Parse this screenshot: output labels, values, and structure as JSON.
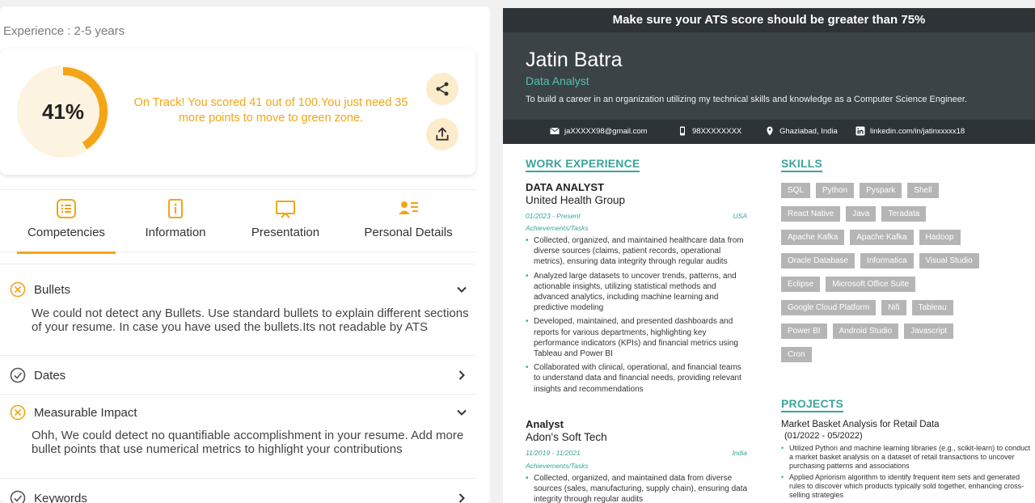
{
  "experience": "Experience : 2-5 years",
  "score": {
    "percent_label": "41%",
    "fraction": 0.41,
    "message": "On Track! You scored 41 out of 100.You just need 35 more points to move to green zone."
  },
  "colors": {
    "accent": "#f2a516",
    "teal": "#3aa597",
    "dark": "#2d3336",
    "chip": "#b5b5b5"
  },
  "tabs": [
    {
      "label": "Competencies",
      "icon": "list-icon",
      "active": true
    },
    {
      "label": "Information",
      "icon": "info-icon",
      "active": false
    },
    {
      "label": "Presentation",
      "icon": "presentation-icon",
      "active": false
    },
    {
      "label": "Personal Details",
      "icon": "person-details-icon",
      "active": false
    }
  ],
  "checks": [
    {
      "title": "Bullets",
      "status": "fail",
      "expanded": true,
      "body": "We could not detect any Bullets. Use standard bullets to explain different sections of your resume. In case you have used the bullets.Its not readable by ATS"
    },
    {
      "title": "Dates",
      "status": "pass",
      "expanded": false,
      "body": ""
    },
    {
      "title": "Measurable Impact",
      "status": "fail",
      "expanded": true,
      "body": "Ohh, We could detect no quantifiable accomplishment in your resume. Add more bullet points that use numerical metrics to highlight your contributions"
    },
    {
      "title": "Keywords",
      "status": "pass",
      "expanded": false,
      "body": ""
    }
  ],
  "resume": {
    "banner": "Make sure your ATS score should be greater than 75%",
    "name": "Jatin Batra",
    "role": "Data Analyst",
    "objective": "To build a career in an organization utilizing my technical skills and knowledge as a Computer Science Engineer.",
    "contact": {
      "email": "jaXXXXX98@gmail.com",
      "phone": "98XXXXXXXX",
      "location": "Ghaziabad, India",
      "linkedin": "linkedin.com/in/jatinxxxxx18"
    },
    "work_title": "WORK EXPERIENCE",
    "jobs": [
      {
        "title": "DATA ANALYST",
        "company": "United Health Group",
        "dates": "01/2023 - Present",
        "location": "USA",
        "ach_label": "Achievements/Tasks",
        "bullets": [
          "Collected, organized, and maintained healthcare data from diverse sources (claims, patient records, operational metrics), ensuring data integrity through regular audits",
          "Analyzed large datasets to uncover trends, patterns, and actionable insights, utilizing statistical methods and advanced analytics, including machine learning and predictive modeling",
          "Developed, maintained, and presented dashboards and reports for various departments, highlighting key performance indicators (KPIs) and financial metrics using Tableau and Power BI",
          "Collaborated with clinical, operational, and financial teams to understand data and financial needs, providing relevant insights and recommendations"
        ]
      },
      {
        "title": "Analyst",
        "company": "Adon's Soft Tech",
        "dates": "11/2019 - 11/2021",
        "location": "India",
        "ach_label": "Achievements/Tasks",
        "bullets": [
          "Collected, organized, and maintained data from diverse sources (sales, manufacturing, supply chain), ensuring data integrity through regular audits"
        ]
      }
    ],
    "skills_title": "SKILLS",
    "skills": [
      [
        "SQL",
        "Python",
        "Pyspark",
        "Shell"
      ],
      [
        "React Native",
        "Java",
        "Teradata"
      ],
      [
        "Apache Kafka",
        "Apache Kafka",
        "Hadoop"
      ],
      [
        "Oracle Database",
        "Informatica",
        "Visual Studio"
      ],
      [
        "Eclipse",
        "Microsoft Office Suite"
      ],
      [
        "Google Cloud Platform",
        "Nifi",
        "Tableau"
      ],
      [
        "Power BI",
        "Android Studio",
        "Javascript"
      ],
      [
        "Cron"
      ]
    ],
    "projects_title": "PROJECTS",
    "project": {
      "title": "Market Basket Analysis for Retail Data",
      "dates": "(01/2022 - 05/2022)",
      "bullets": [
        "Utilized Python and machine learning libraries (e.g., scikit-learn) to conduct a market basket analysis on a dataset of retail transactions to uncover purchasing patterns and associations",
        "Applied Apriorism algorithm to identify frequent item sets and generated rules to discover which products typically sold together, enhancing cross-selling strategies"
      ]
    }
  }
}
